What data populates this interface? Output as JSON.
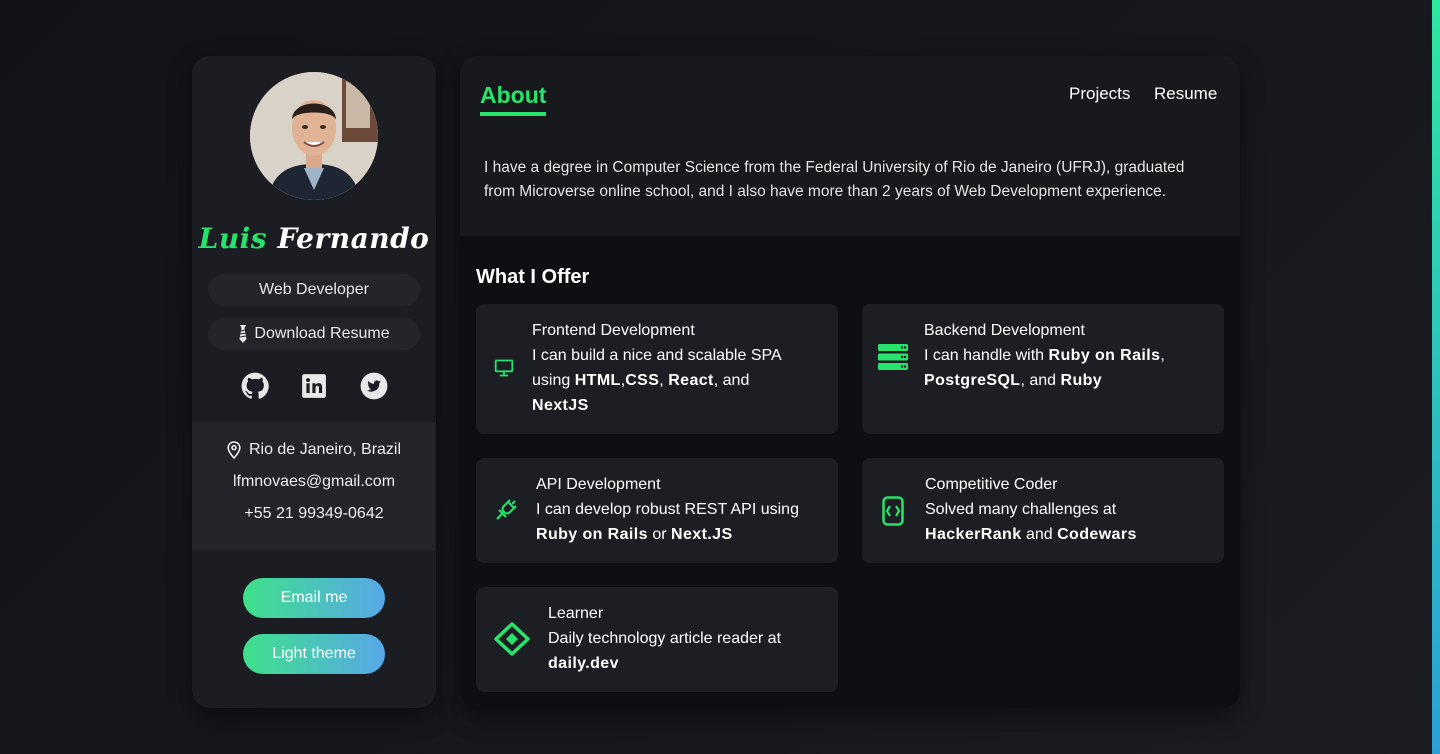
{
  "profile": {
    "first_name": "Luis",
    "last_name": "Fernando",
    "role": "Web Developer",
    "download_label": "Download Resume",
    "location": "Rio de Janeiro, Brazil",
    "email": "lfmnovaes@gmail.com",
    "phone": "+55 21 99349-0642",
    "email_button": "Email me",
    "theme_button": "Light theme"
  },
  "socials": [
    "github-icon",
    "linkedin-icon",
    "twitter-icon"
  ],
  "nav": {
    "active": "About",
    "projects": "Projects",
    "resume": "Resume"
  },
  "about": {
    "line1": "I have a degree in Computer Science from the Federal University of Rio de Janeiro (UFRJ), graduated",
    "line2": "from Microverse online school, and I also have more than 2 years of Web Development experience."
  },
  "offer": {
    "title": "What I Offer",
    "frontend": {
      "title": "Frontend Development",
      "t1": "I can build a nice and scalable SPA",
      "t2": "using ",
      "b1": "HTML",
      "s1": ",",
      "b2": "CSS",
      "s2": ", ",
      "b3": "React",
      "s3": ", and",
      "b4": "NextJS"
    },
    "backend": {
      "title": "Backend Development",
      "t1": "I can handle with ",
      "b1": "Ruby on Rails",
      "s1": ",",
      "b2": "PostgreSQL",
      "s2": ", and ",
      "b3": "Ruby"
    },
    "api": {
      "title": "API Development",
      "t1": "I can develop robust REST API using",
      "b1": "Ruby on Rails",
      "s1": " or ",
      "b2": "Next.JS"
    },
    "competitive": {
      "title": "Competitive Coder",
      "t1": "Solved many challenges at",
      "b1": "HackerRank",
      "s1": " and ",
      "b2": "Codewars"
    },
    "learner": {
      "title": "Learner",
      "t1": "Daily technology article reader at",
      "b1": "daily.dev"
    }
  },
  "colors": {
    "accent": "#27e36b",
    "card": "#1c1e23",
    "sidebar": "#1b1d22",
    "main": "#0d0f12"
  }
}
